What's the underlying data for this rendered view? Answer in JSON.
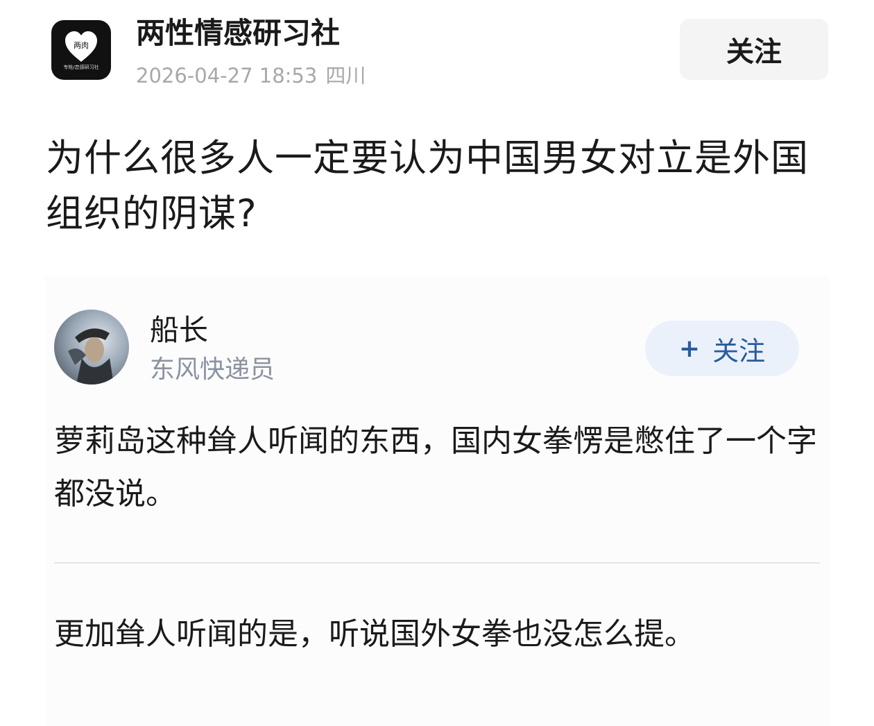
{
  "header": {
    "account_name": "两性情感研习社",
    "avatar_badge": "两肉",
    "avatar_tagline": "专姓/恋感研习社",
    "date": "2026-04-27 18:53",
    "location": "四川",
    "follow_label": "关注"
  },
  "post": {
    "title": "为什么很多人一定要认为中国男女对立是外国组织的阴谋?"
  },
  "answer": {
    "author": "船长",
    "author_desc": "东风快递员",
    "follow_plus": "+",
    "follow_label": "关注",
    "paragraphs": [
      "萝莉岛这种耸人听闻的东西，国内女拳愣是憋住了一个字都没说。",
      "更加耸人听闻的是，听说国外女拳也没怎么提。"
    ]
  },
  "colors": {
    "accent_blue": "#2a5aa0",
    "follow_bg": "#eaf1fb",
    "meta_gray": "#a8a8a8"
  }
}
